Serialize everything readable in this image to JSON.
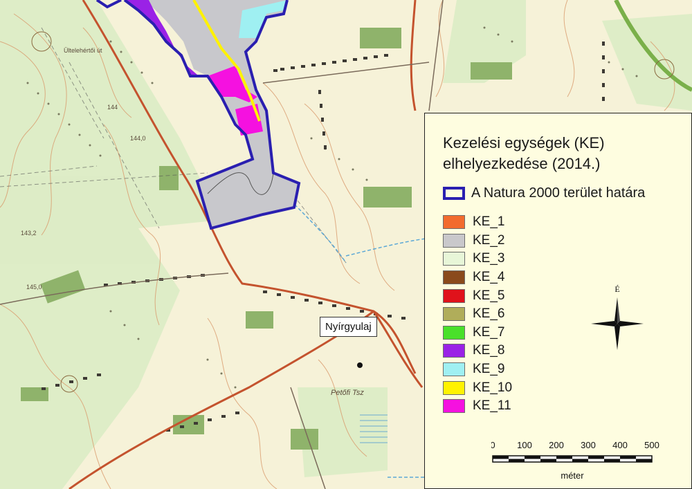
{
  "legend": {
    "title_line1": "Kezelési egységek (KE)",
    "title_line2": "elhelyezkedése (2014.)",
    "boundary_label": "A Natura 2000 terület határa",
    "boundary_color": "#2a1fb0",
    "items": [
      {
        "label": "KE_1",
        "color": "#f26b2e"
      },
      {
        "label": "KE_2",
        "color": "#c9c8cb"
      },
      {
        "label": "KE_3",
        "color": "#e8f6d8"
      },
      {
        "label": "KE_4",
        "color": "#8a4a1c"
      },
      {
        "label": "KE_5",
        "color": "#e0121b"
      },
      {
        "label": "KE_6",
        "color": "#b0ad5a"
      },
      {
        "label": "KE_7",
        "color": "#49e02a"
      },
      {
        "label": "KE_8",
        "color": "#9a22e6"
      },
      {
        "label": "KE_9",
        "color": "#9ff0f2"
      },
      {
        "label": "KE_10",
        "color": "#fff200"
      },
      {
        "label": "KE_11",
        "color": "#f511e0"
      }
    ]
  },
  "north_arrow": {
    "label": "É"
  },
  "scale": {
    "ticks": [
      "0",
      "100",
      "200",
      "300",
      "400",
      "500"
    ],
    "unit": "méter"
  },
  "map_labels": {
    "town": "Nyírgyulaj",
    "road_label": "Ültelehértői út",
    "place_label": "Petőfi Tsz",
    "spot_1": "144",
    "spot_2": "144,0",
    "spot_3": "143,2",
    "spot_4": "145,0"
  }
}
